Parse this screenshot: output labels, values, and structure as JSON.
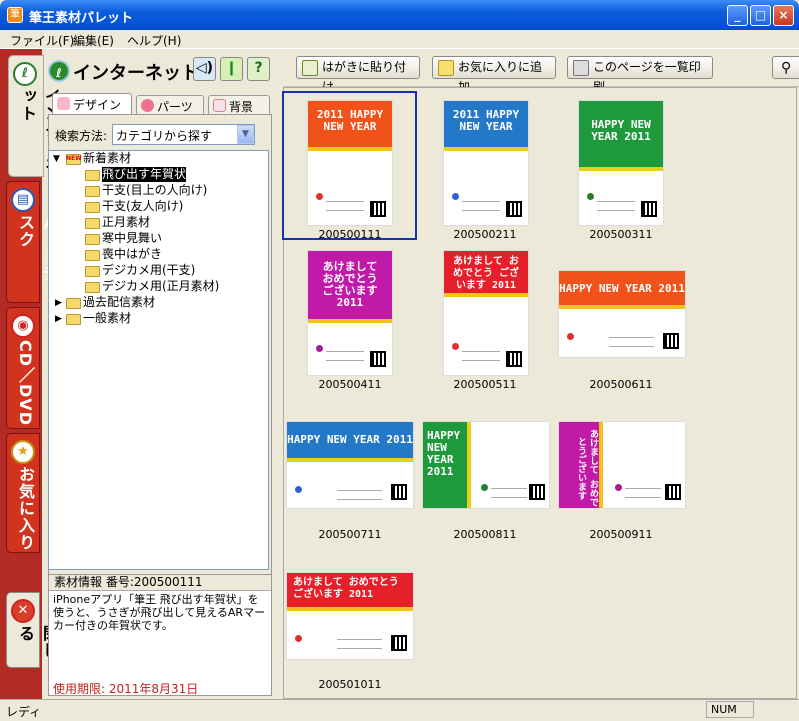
{
  "window": {
    "title": "筆王素材パレット",
    "app_icon": "筆",
    "minimize": "_",
    "maximize": "□",
    "close": "×"
  },
  "menu": [
    "ファイル(F)",
    "編集(E)",
    "ヘルプ(H)"
  ],
  "side_tabs": [
    {
      "label": "インターネット",
      "icon": "leaf-icon",
      "glyph": "ℓ",
      "active": true
    },
    {
      "label": "ハードディスク",
      "icon": "harddisk-icon",
      "glyph": "▤",
      "active": false
    },
    {
      "label": "CD／DVD",
      "icon": "disc-icon",
      "glyph": "◉",
      "active": false
    },
    {
      "label": "お気に入り",
      "icon": "star-icon",
      "glyph": "★",
      "active": false
    },
    {
      "label": "閉じる",
      "icon": "close-x-icon",
      "glyph": "✕",
      "active": false
    }
  ],
  "panel": {
    "title": "インターネット",
    "icon_glyph": "ℓ",
    "btn_sound": "◁)",
    "btn_beginner": "❙",
    "btn_help": "?"
  },
  "sub_tabs": [
    "デザイン",
    "パーツ",
    "背景"
  ],
  "search": {
    "label": "検索方法:",
    "value": "カテゴリから探す"
  },
  "tree": {
    "root": {
      "label": "新着素材",
      "badge": "NEW"
    },
    "children": [
      "飛び出す年賀状",
      "干支(目上の人向け)",
      "干支(友人向け)",
      "正月素材",
      "寒中見舞い",
      "喪中はがき",
      "デジカメ用(干支)",
      "デジカメ用(正月素材)"
    ],
    "others": [
      "過去配信素材",
      "一般素材"
    ],
    "selected": "飛び出す年賀状"
  },
  "info": {
    "header": "素材情報 番号:200500111",
    "text": "iPhoneアプリ「筆王 飛び出す年賀状」を使うと、うさぎが飛び出して見えるARマーカー付きの年賀状です。",
    "expiry": "使用期限: 2011年8月31日"
  },
  "toolbar": [
    "はがきに貼り付け",
    "お気に入りに追加",
    "このページを一覧印刷"
  ],
  "cards": [
    {
      "id": "200500111",
      "text": "2011 HAPPY NEW YEAR",
      "color": "#f0521a"
    },
    {
      "id": "200500211",
      "text": "2011 HAPPY NEW YEAR",
      "color": "#2478c8"
    },
    {
      "id": "200500311",
      "text": "HAPPY NEW YEAR 2011",
      "color": "#1e9a3c"
    },
    {
      "id": "200500411",
      "text": "あけまして おめでとう ございます 2011",
      "color": "#c21aa8"
    },
    {
      "id": "200500511",
      "text": "あけまして おめでとう ございます 2011",
      "color": "#e5202a"
    },
    {
      "id": "200500611",
      "text": "HAPPY NEW YEAR 2011",
      "color": "#f0521a"
    },
    {
      "id": "200500711",
      "text": "HAPPY NEW YEAR 2011",
      "color": "#2478c8"
    },
    {
      "id": "200500811",
      "text": "HAPPY NEW YEAR 2011",
      "color": "#1e9a3c"
    },
    {
      "id": "200500911",
      "text": "あけまして おめでとうございます",
      "color": "#c21aa8"
    },
    {
      "id": "200501011",
      "text": "あけまして おめでとうございます 2011",
      "color": "#e5202a"
    }
  ],
  "status": {
    "text": "レディ",
    "num": "NUM"
  }
}
